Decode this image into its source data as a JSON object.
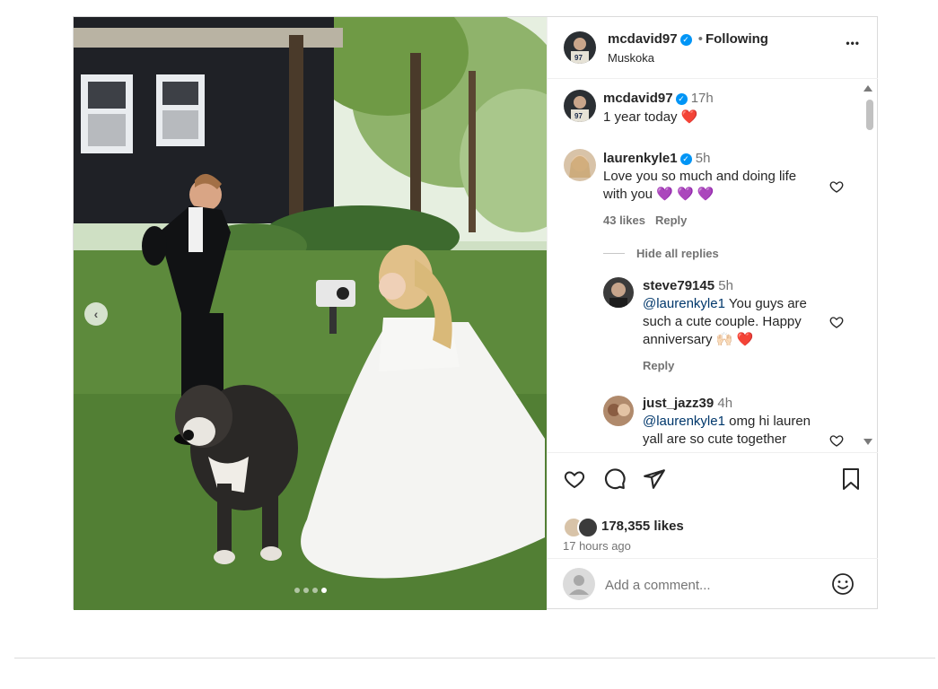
{
  "post": {
    "author": "mcdavid97",
    "follow_sep": "•",
    "follow_status": "Following",
    "location": "Muskoka",
    "more_label": "•••",
    "caption": {
      "username": "mcdavid97",
      "time": "17h",
      "text": "1 year today",
      "emoji": "❤️"
    },
    "media": {
      "carousel_dots": 4,
      "active_dot": 4,
      "prev_arrow": "‹"
    }
  },
  "comments": [
    {
      "username": "laurenkyle1",
      "verified": true,
      "time": "5h",
      "text_line1": "Love you so much and doing life",
      "text_line2": "with you",
      "emoji": "💜 💜 💜",
      "likes": "43 likes",
      "reply_label": "Reply",
      "hide_replies": "Hide all replies"
    }
  ],
  "replies": [
    {
      "username": "steve79145",
      "time": "5h",
      "mention": "@laurenkyle1",
      "text_part1": "You guys are",
      "text_part2": "such a cute couple. Happy",
      "text_part3": "anniversary",
      "emoji": "🙌🏻 ❤️",
      "reply_label": "Reply"
    },
    {
      "username": "just_jazz39",
      "time": "4h",
      "mention": "@laurenkyle1",
      "text_part1": "omg hi lauren",
      "text_part2": "yall are so cute together"
    }
  ],
  "actions": {
    "likes": "178,355 likes",
    "time_ago": "17 hours ago",
    "icons": [
      "heart-icon",
      "comment-icon",
      "share-icon",
      "bookmark-icon"
    ]
  },
  "add_comment": {
    "placeholder": "Add a comment...",
    "emoji_icon": "☺"
  },
  "colors": {
    "verified": "#0095f6",
    "link": "#00376b",
    "muted": "#737373",
    "border": "#dbdbdb"
  }
}
